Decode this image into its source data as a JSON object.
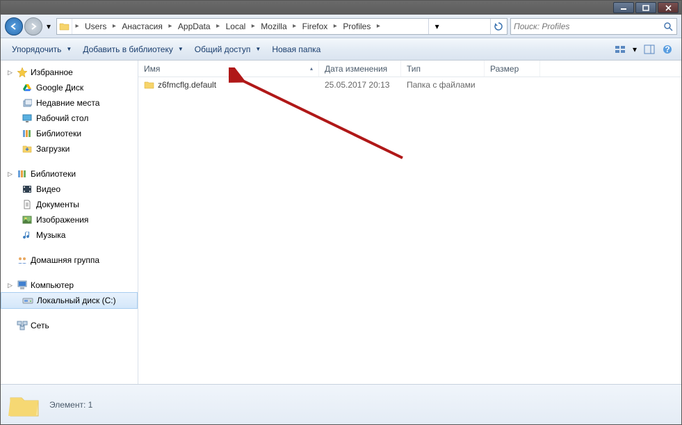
{
  "breadcrumbs": [
    "Users",
    "Анастасия",
    "AppData",
    "Local",
    "Mozilla",
    "Firefox",
    "Profiles"
  ],
  "search": {
    "placeholder": "Поиск: Profiles"
  },
  "toolbar": {
    "organize": "Упорядочить",
    "library": "Добавить в библиотеку",
    "share": "Общий доступ",
    "newfolder": "Новая папка"
  },
  "nav": {
    "favorites": {
      "label": "Избранное",
      "items": [
        "Google Диск",
        "Недавние места",
        "Рабочий стол",
        "Библиотеки",
        "Загрузки"
      ]
    },
    "libraries": {
      "label": "Библиотеки",
      "items": [
        "Видео",
        "Документы",
        "Изображения",
        "Музыка"
      ]
    },
    "homegroup": {
      "label": "Домашняя группа"
    },
    "computer": {
      "label": "Компьютер",
      "items": [
        "Локальный диск (C:)"
      ]
    },
    "network": {
      "label": "Сеть"
    }
  },
  "columns": {
    "name": "Имя",
    "date": "Дата изменения",
    "type": "Тип",
    "size": "Размер"
  },
  "rows": [
    {
      "name": "z6fmcflg.default",
      "date": "25.05.2017 20:13",
      "type": "Папка с файлами",
      "size": ""
    }
  ],
  "details": {
    "line1": "Элемент: 1"
  }
}
